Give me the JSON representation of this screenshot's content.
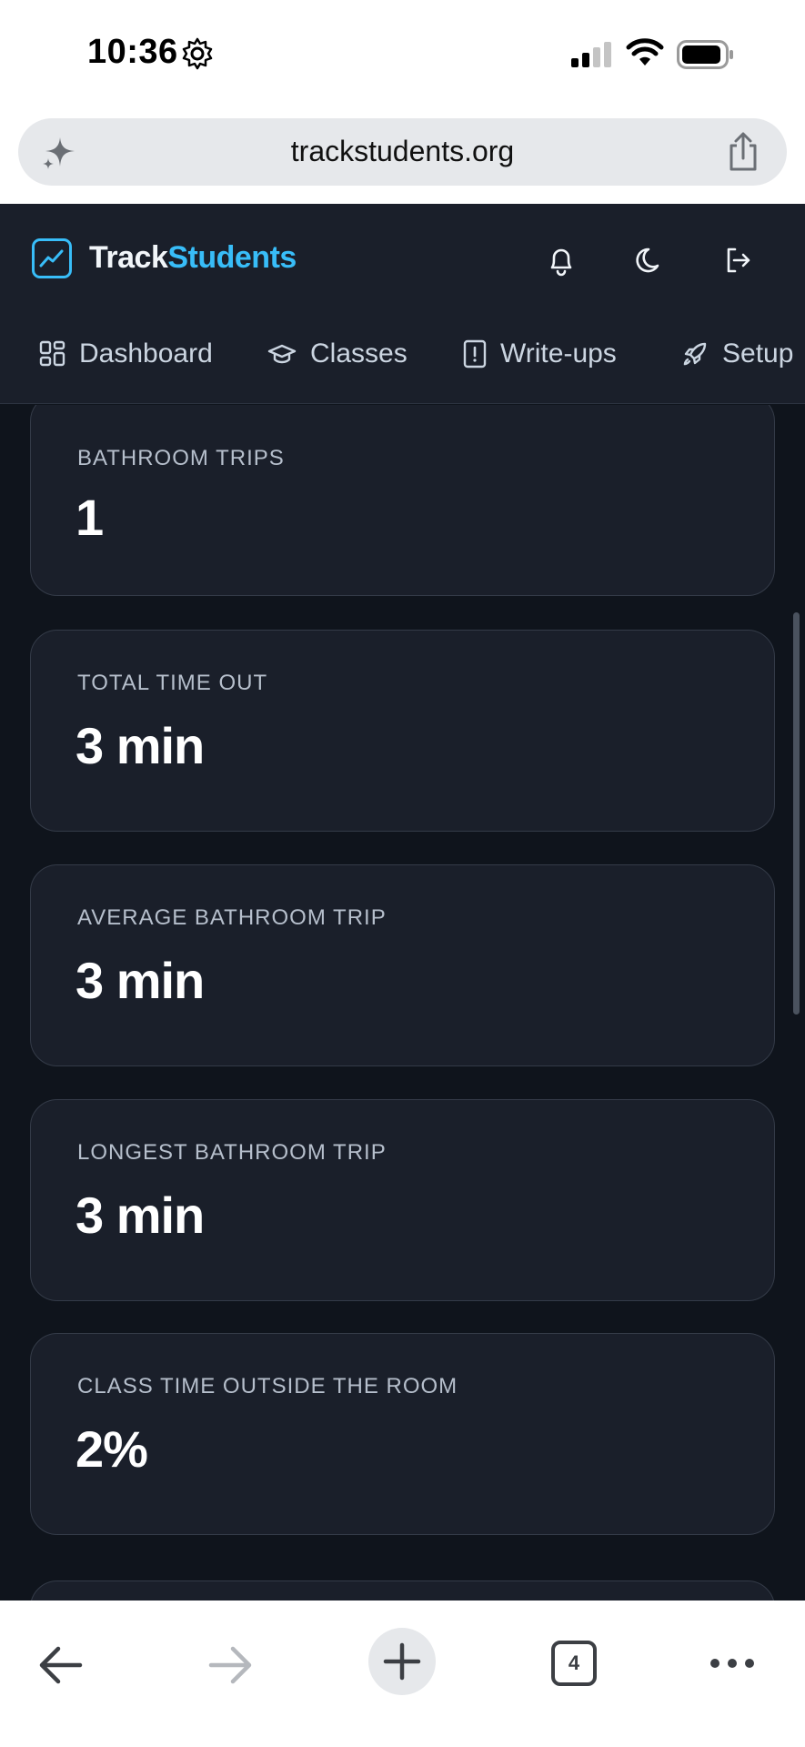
{
  "status_bar": {
    "time": "10:36"
  },
  "browser": {
    "url": "trackstudents.org",
    "tab_count": "4"
  },
  "app": {
    "brand_part1": "Track",
    "brand_part2": "Students",
    "nav": [
      {
        "label": "Dashboard",
        "icon": "dashboard-grid-icon"
      },
      {
        "label": "Classes",
        "icon": "graduation-cap-icon"
      },
      {
        "label": "Write-ups",
        "icon": "alert-file-icon"
      },
      {
        "label": "Setup",
        "icon": "rocket-icon"
      }
    ],
    "header_icons": [
      "bell-icon",
      "moon-icon",
      "logout-icon"
    ],
    "colors": {
      "accent": "#38bdf8",
      "background": "#0f141c",
      "card": "#1a1f2a"
    }
  },
  "stats": [
    {
      "label": "BATHROOM TRIPS",
      "value": "1"
    },
    {
      "label": "TOTAL TIME OUT",
      "value": "3 min"
    },
    {
      "label": "AVERAGE BATHROOM TRIP",
      "value": "3 min"
    },
    {
      "label": "LONGEST BATHROOM TRIP",
      "value": "3 min"
    },
    {
      "label": "CLASS TIME OUTSIDE THE ROOM",
      "value": "2%"
    }
  ]
}
